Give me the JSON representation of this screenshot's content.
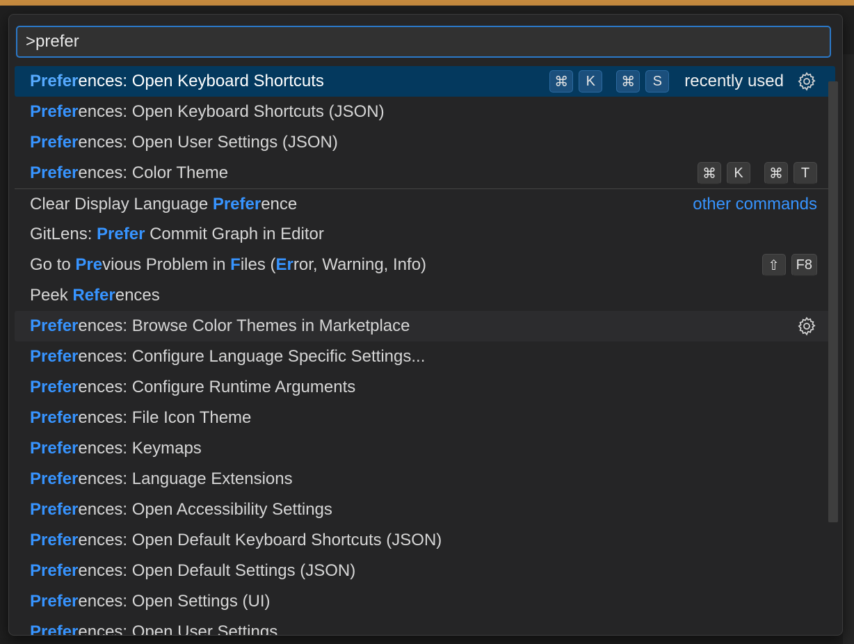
{
  "search": {
    "value": ">prefer"
  },
  "items": [
    {
      "pre": "",
      "hl": "Prefer",
      "post": "ences: Open Keyboard Shortcuts",
      "keys": [
        [
          "⌘",
          "K"
        ],
        [
          "⌘",
          "S"
        ]
      ],
      "tag": "recently used",
      "gear": true,
      "state": "selected"
    },
    {
      "pre": "",
      "hl": "Prefer",
      "post": "ences: Open Keyboard Shortcuts (JSON)"
    },
    {
      "pre": "",
      "hl": "Prefer",
      "post": "ences: Open User Settings (JSON)"
    },
    {
      "pre": "",
      "hl": "Prefer",
      "post": "ences: Color Theme",
      "keys": [
        [
          "⌘",
          "K"
        ],
        [
          "⌘",
          "T"
        ]
      ]
    },
    {
      "pre": "Clear Display Language ",
      "hl": "Prefer",
      "post": "ence",
      "tag": "other commands"
    },
    {
      "pre": "GitLens: ",
      "hl": "Prefer",
      "post": " Commit Graph in Editor"
    },
    {
      "segments": [
        {
          "t": "Go to "
        },
        {
          "t": "Pre",
          "h": true
        },
        {
          "t": "vious Problem in "
        },
        {
          "t": "F",
          "h": true
        },
        {
          "t": "iles ("
        },
        {
          "t": "Er",
          "h": true
        },
        {
          "t": "ror, Warning, Info)"
        }
      ],
      "keys": [
        [
          "⇧",
          "F8"
        ]
      ]
    },
    {
      "segments": [
        {
          "t": "Peek "
        },
        {
          "t": "Refer",
          "h": true
        },
        {
          "t": "ences"
        }
      ]
    },
    {
      "pre": "",
      "hl": "Prefer",
      "post": "ences: Browse Color Themes in Marketplace",
      "gear": true,
      "state": "hover"
    },
    {
      "pre": "",
      "hl": "Prefer",
      "post": "ences: Configure Language Specific Settings..."
    },
    {
      "pre": "",
      "hl": "Prefer",
      "post": "ences: Configure Runtime Arguments"
    },
    {
      "pre": "",
      "hl": "Prefer",
      "post": "ences: File Icon Theme"
    },
    {
      "pre": "",
      "hl": "Prefer",
      "post": "ences: Keymaps"
    },
    {
      "pre": "",
      "hl": "Prefer",
      "post": "ences: Language Extensions"
    },
    {
      "pre": "",
      "hl": "Prefer",
      "post": "ences: Open Accessibility Settings"
    },
    {
      "pre": "",
      "hl": "Prefer",
      "post": "ences: Open Default Keyboard Shortcuts (JSON)"
    },
    {
      "pre": "",
      "hl": "Prefer",
      "post": "ences: Open Default Settings (JSON)"
    },
    {
      "pre": "",
      "hl": "Prefer",
      "post": "ences: Open Settings (UI)"
    },
    {
      "pre": "",
      "hl": "Prefer",
      "post": "ences: Open User Settings"
    }
  ],
  "colors": {
    "highlight": "#3794ff",
    "selected_bg": "#04395e",
    "accent_border": "#2b79c9"
  }
}
